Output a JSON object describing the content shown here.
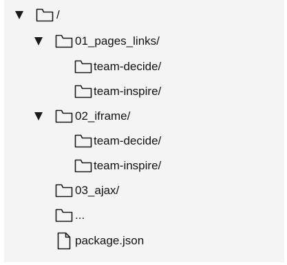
{
  "tree": {
    "root": {
      "label": "/",
      "icon": "folder-icon",
      "expanded": true
    },
    "items": [
      {
        "label": "01_pages_links/",
        "icon": "folder-icon",
        "expanded": true
      },
      {
        "label": "team-decide/",
        "icon": "folder-icon"
      },
      {
        "label": "team-inspire/",
        "icon": "folder-icon"
      },
      {
        "label": "02_iframe/",
        "icon": "folder-icon",
        "expanded": true
      },
      {
        "label": "team-decide/",
        "icon": "folder-icon"
      },
      {
        "label": "team-inspire/",
        "icon": "folder-icon"
      },
      {
        "label": "03_ajax/",
        "icon": "folder-icon"
      },
      {
        "label": "...",
        "icon": "folder-icon"
      },
      {
        "label": "package.json",
        "icon": "file-icon"
      }
    ]
  },
  "colors": {
    "background": "#f4f4f4",
    "text": "#111111",
    "icon_stroke": "#1a1a1a"
  }
}
